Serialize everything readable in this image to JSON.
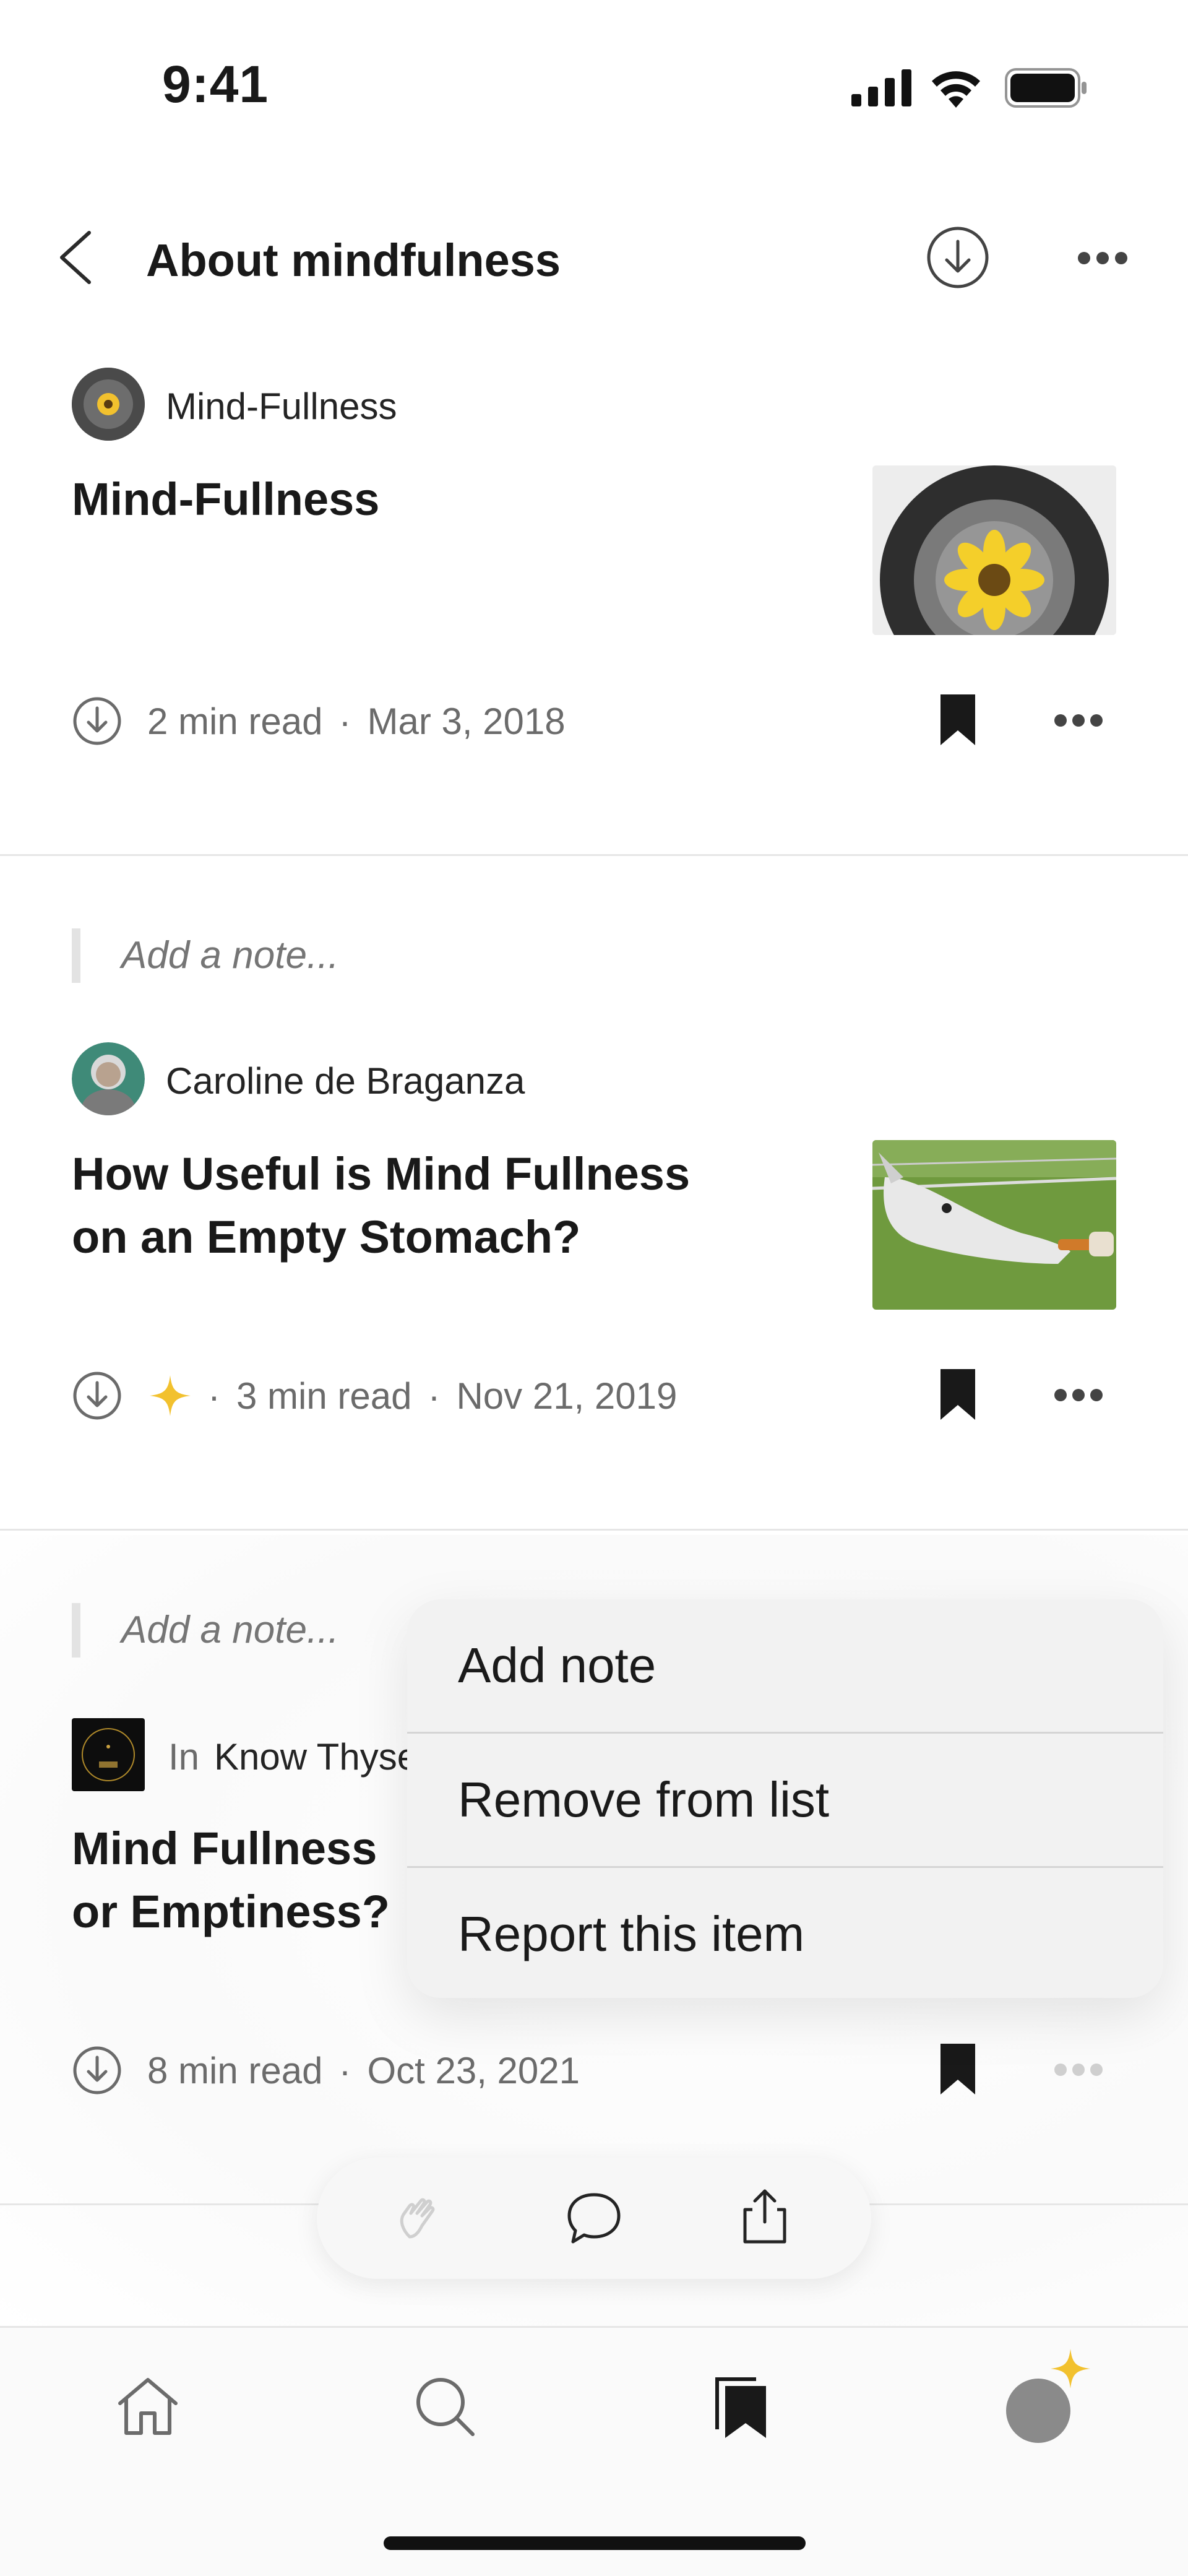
{
  "status_bar": {
    "time": "9:41"
  },
  "header": {
    "title": "About mindfulness"
  },
  "items": [
    {
      "author": "Mind-Fullness",
      "title": "Mind-Fullness",
      "read_time": "2  min read",
      "date": "Mar 3, 2018"
    },
    {
      "note_placeholder": "Add a note...",
      "author": "Caroline de Braganza",
      "title": "How Useful is Mind Fullness on an Empty Stomach?",
      "read_time": "3  min read",
      "date": "Nov 21, 2019"
    },
    {
      "note_placeholder": "Add a note...",
      "in_label": "In",
      "publication": "Know Thyse",
      "title": "Mind Fullness or Emptiness?",
      "read_time": "8  min read",
      "date": "Oct 23, 2021"
    }
  ],
  "context_menu": {
    "add_note": "Add note",
    "remove": "Remove from list",
    "report": "Report this item"
  },
  "colors": {
    "accent_star": "#f2c12e",
    "text": "#191919",
    "muted": "#6b6b6b"
  },
  "icons": {
    "fab": [
      "clap-icon",
      "comment-icon",
      "share-icon"
    ],
    "tabs": [
      "home-icon",
      "search-icon",
      "library-icon",
      "profile-avatar"
    ]
  }
}
